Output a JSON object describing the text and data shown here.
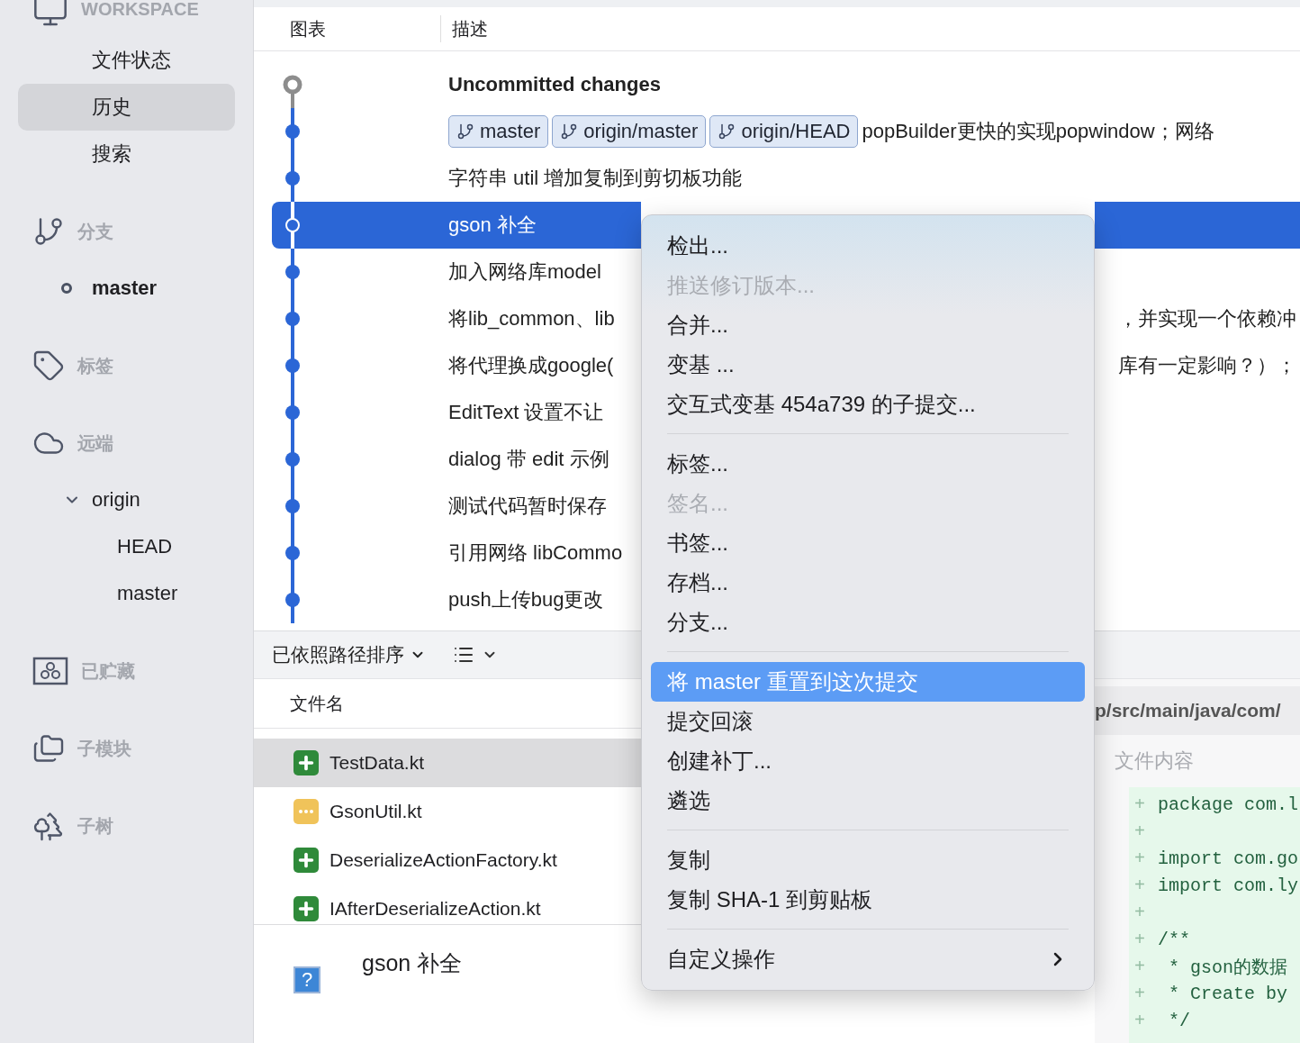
{
  "sidebar": {
    "workspace": {
      "title": "WORKSPACE",
      "items": [
        {
          "label": "文件状态",
          "selected": false
        },
        {
          "label": "历史",
          "selected": true
        },
        {
          "label": "搜索",
          "selected": false
        }
      ]
    },
    "sections": [
      {
        "kind": "branches",
        "title": "分支",
        "items": [
          {
            "label": "master",
            "current": true
          }
        ]
      },
      {
        "kind": "tags",
        "title": "标签"
      },
      {
        "kind": "remotes",
        "title": "远端",
        "items": [
          {
            "label": "origin",
            "expanded": true,
            "children": [
              {
                "label": "HEAD"
              },
              {
                "label": "master"
              }
            ]
          }
        ]
      },
      {
        "kind": "stashes",
        "title": "已贮藏"
      },
      {
        "kind": "submodules",
        "title": "子模块"
      },
      {
        "kind": "subtrees",
        "title": "子树"
      }
    ]
  },
  "history": {
    "columns": [
      "图表",
      "描述"
    ],
    "commits": [
      {
        "kind": "uncommitted",
        "description": "Uncommitted changes",
        "selected": false
      },
      {
        "kind": "commit",
        "refs": [
          "master",
          "origin/master",
          "origin/HEAD"
        ],
        "description": "popBuilder更快的实现popwindow；网络",
        "selected": false
      },
      {
        "kind": "commit",
        "description": "字符串 util 增加复制到剪切板功能",
        "selected": false
      },
      {
        "kind": "commit",
        "description": "gson 补全",
        "selected": true
      },
      {
        "kind": "commit",
        "description": "加入网络库model",
        "selected": false
      },
      {
        "kind": "commit",
        "description": "将lib_common、lib",
        "description_tail": "，并实现一个依赖冲",
        "selected": false
      },
      {
        "kind": "commit",
        "description": "将代理换成google(",
        "description_tail": "库有一定影响？）；",
        "selected": false
      },
      {
        "kind": "commit",
        "description": "EditText 设置不让",
        "selected": false
      },
      {
        "kind": "commit",
        "description": "dialog 带 edit 示例",
        "selected": false
      },
      {
        "kind": "commit",
        "description": "测试代码暂时保存",
        "selected": false
      },
      {
        "kind": "commit",
        "description": "引用网络 libCommo",
        "selected": false
      },
      {
        "kind": "commit",
        "description": "push上传bug更改",
        "selected": false
      }
    ]
  },
  "files": {
    "sort_label": "已依照路径排序",
    "columns": [
      "文件名"
    ],
    "rows": [
      {
        "kind": "added",
        "name": "TestData.kt",
        "selected": true
      },
      {
        "kind": "modified",
        "name": "GsonUtil.kt",
        "selected": false
      },
      {
        "kind": "added",
        "name": "DeserializeActionFactory.kt",
        "selected": false
      },
      {
        "kind": "added",
        "name": "IAfterDeserializeAction.kt",
        "selected": false
      }
    ]
  },
  "commit_detail": {
    "avatar": "?",
    "message": "gson 补全"
  },
  "diff": {
    "path": "p/src/main/java/com/",
    "title": "文件内容",
    "lines": [
      {
        "marker": "+",
        "text": "package com.l"
      },
      {
        "marker": "+"
      },
      {
        "marker": "+",
        "text": "import com.go"
      },
      {
        "marker": "+",
        "text": "import com.ly"
      },
      {
        "marker": "+"
      },
      {
        "marker": "+",
        "text": "/**"
      },
      {
        "marker": "+",
        "text": " * gson的数据"
      },
      {
        "marker": "+",
        "text": " * Create by"
      },
      {
        "marker": "+",
        "text": " */"
      }
    ]
  },
  "context_menu": {
    "items": [
      {
        "kind": "item",
        "label": "检出...",
        "disabled": false,
        "selected": false,
        "submenu": false
      },
      {
        "kind": "item",
        "label": "推送修订版本...",
        "disabled": true,
        "selected": false,
        "submenu": false
      },
      {
        "kind": "item",
        "label": "合并...",
        "disabled": false,
        "selected": false,
        "submenu": false
      },
      {
        "kind": "item",
        "label": "变基 ...",
        "disabled": false,
        "selected": false,
        "submenu": false
      },
      {
        "kind": "item",
        "label": "交互式变基 454a739 的子提交...",
        "disabled": false,
        "selected": false,
        "submenu": false
      },
      {
        "kind": "separator"
      },
      {
        "kind": "item",
        "label": "标签...",
        "disabled": false,
        "selected": false,
        "submenu": false
      },
      {
        "kind": "item",
        "label": "签名...",
        "disabled": true,
        "selected": false,
        "submenu": false
      },
      {
        "kind": "item",
        "label": "书签...",
        "disabled": false,
        "selected": false,
        "submenu": false
      },
      {
        "kind": "item",
        "label": "存档...",
        "disabled": false,
        "selected": false,
        "submenu": false
      },
      {
        "kind": "item",
        "label": "分支...",
        "disabled": false,
        "selected": false,
        "submenu": false
      },
      {
        "kind": "separator"
      },
      {
        "kind": "item",
        "label": "将 master 重置到这次提交",
        "disabled": false,
        "selected": true,
        "submenu": false
      },
      {
        "kind": "item",
        "label": "提交回滚",
        "disabled": false,
        "selected": false,
        "submenu": false
      },
      {
        "kind": "item",
        "label": "创建补丁...",
        "disabled": false,
        "selected": false,
        "submenu": false
      },
      {
        "kind": "item",
        "label": "遴选",
        "disabled": false,
        "selected": false,
        "submenu": false
      },
      {
        "kind": "separator"
      },
      {
        "kind": "item",
        "label": "复制",
        "disabled": false,
        "selected": false,
        "submenu": false
      },
      {
        "kind": "item",
        "label": "复制 SHA-1 到剪贴板",
        "disabled": false,
        "selected": false,
        "submenu": false
      },
      {
        "kind": "separator"
      },
      {
        "kind": "item",
        "label": "自定义操作",
        "disabled": false,
        "selected": false,
        "submenu": true
      }
    ]
  }
}
